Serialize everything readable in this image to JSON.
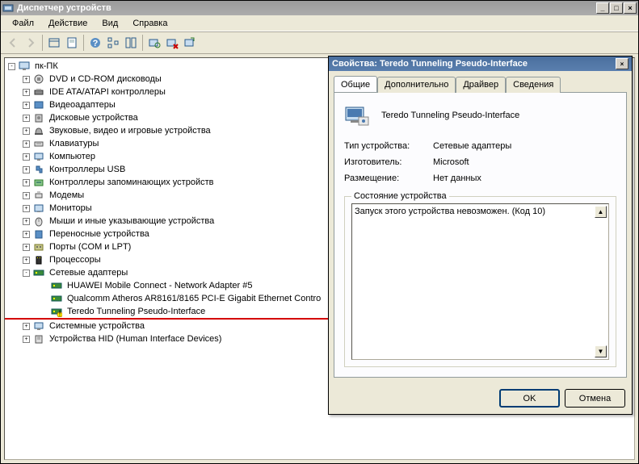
{
  "window": {
    "title": "Диспетчер устройств"
  },
  "menu": {
    "file": "Файл",
    "action": "Действие",
    "view": "Вид",
    "help": "Справка"
  },
  "tree": {
    "root": "пк-ПК",
    "items": [
      "DVD и CD-ROM дисководы",
      "IDE ATA/ATAPI контроллеры",
      "Видеоадаптеры",
      "Дисковые устройства",
      "Звуковые, видео и игровые устройства",
      "Клавиатуры",
      "Компьютер",
      "Контроллеры USB",
      "Контроллеры запоминающих устройств",
      "Модемы",
      "Мониторы",
      "Мыши и иные указывающие устройства",
      "Переносные устройства",
      "Порты (COM и LPT)",
      "Процессоры"
    ],
    "net": {
      "label": "Сетевые адаптеры",
      "children": [
        "HUAWEI Mobile Connect - Network Adapter #5",
        "Qualcomm Atheros AR8161/8165 PCI-E Gigabit Ethernet Contro",
        "Teredo Tunneling Pseudo-Interface"
      ]
    },
    "after": [
      "Системные устройства",
      "Устройства HID (Human Interface Devices)"
    ]
  },
  "dialog": {
    "title": "Свойства: Teredo Tunneling Pseudo-Interface",
    "tabs": {
      "general": "Общие",
      "advanced": "Дополнительно",
      "driver": "Драйвер",
      "details": "Сведения"
    },
    "device_name": "Teredo Tunneling Pseudo-Interface",
    "rows": {
      "type_label": "Тип устройства:",
      "type_value": "Сетевые адаптеры",
      "mfr_label": "Изготовитель:",
      "mfr_value": "Microsoft",
      "loc_label": "Размещение:",
      "loc_value": "Нет данных"
    },
    "status_label": "Состояние устройства",
    "status_text": "Запуск этого устройства невозможен. (Код 10)",
    "ok": "OK",
    "cancel": "Отмена"
  }
}
